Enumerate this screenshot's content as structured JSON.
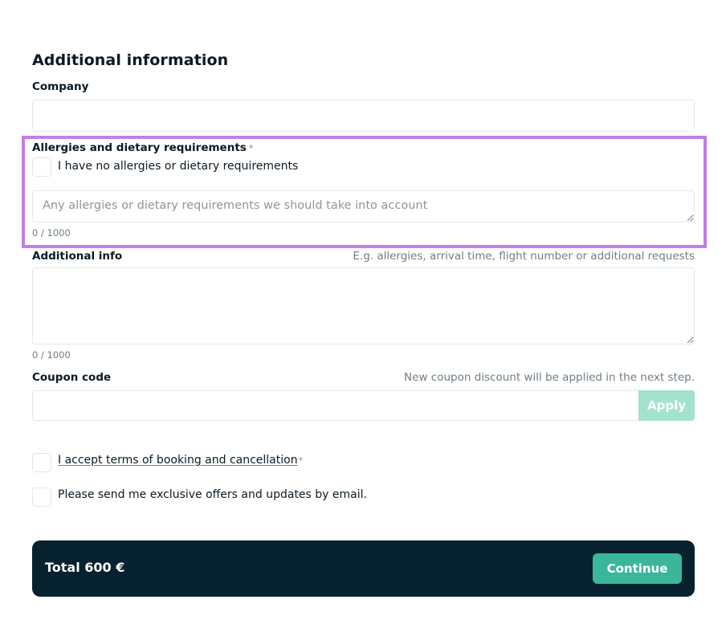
{
  "section": {
    "title": "Additional information"
  },
  "company": {
    "label": "Company",
    "value": "",
    "placeholder": ""
  },
  "allergies": {
    "label": "Allergies and dietary requirements",
    "required_mark": "*",
    "no_allergies_label": "I have no allergies or dietary requirements",
    "placeholder": "Any allergies or dietary requirements we should take into account",
    "value": "",
    "counter": "0 / 1000"
  },
  "additional_info": {
    "label": "Additional info",
    "hint": "E.g. allergies, arrival time, flight number or additional requests",
    "value": "",
    "counter": "0 / 1000"
  },
  "coupon": {
    "label": "Coupon code",
    "hint": "New coupon discount will be applied in the next step.",
    "value": "",
    "apply_label": "Apply"
  },
  "consents": {
    "terms_label": "I accept terms of booking and cancellation",
    "terms_required_mark": "*",
    "newsletter_label": "Please send me exclusive offers and updates by email."
  },
  "footer": {
    "total_label": "Total 600 €",
    "continue_label": "Continue"
  },
  "colors": {
    "highlight": "#c17ee8",
    "accent": "#3cb69a",
    "accent_disabled": "#a3e2cf",
    "footer_bg": "#06222e"
  }
}
